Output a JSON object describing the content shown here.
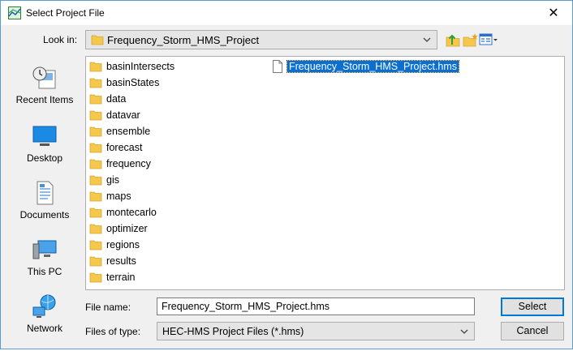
{
  "window": {
    "title": "Select Project File",
    "close_symbol": "✕"
  },
  "lookin": {
    "label": "Look in:",
    "value": "Frequency_Storm_HMS_Project"
  },
  "places": [
    {
      "label": "Recent Items",
      "icon": "recent-items-icon"
    },
    {
      "label": "Desktop",
      "icon": "desktop-icon"
    },
    {
      "label": "Documents",
      "icon": "documents-icon"
    },
    {
      "label": "This PC",
      "icon": "this-pc-icon"
    },
    {
      "label": "Network",
      "icon": "network-icon"
    }
  ],
  "folders": [
    "basinIntersects",
    "basinStates",
    "data",
    "datavar",
    "ensemble",
    "forecast",
    "frequency",
    "gis",
    "maps",
    "montecarlo",
    "optimizer",
    "regions",
    "results",
    "terrain"
  ],
  "files": [
    {
      "name": "Frequency_Storm_HMS_Project.hms",
      "selected": true
    }
  ],
  "file_name": {
    "label": "File name:",
    "value": "Frequency_Storm_HMS_Project.hms"
  },
  "file_type": {
    "label": "Files of type:",
    "value": "HEC-HMS Project Files (*.hms)"
  },
  "buttons": {
    "select": "Select",
    "cancel": "Cancel"
  },
  "colors": {
    "selection": "#0a6fd0",
    "folder": "#f5c84c",
    "accent": "#0078d7"
  }
}
